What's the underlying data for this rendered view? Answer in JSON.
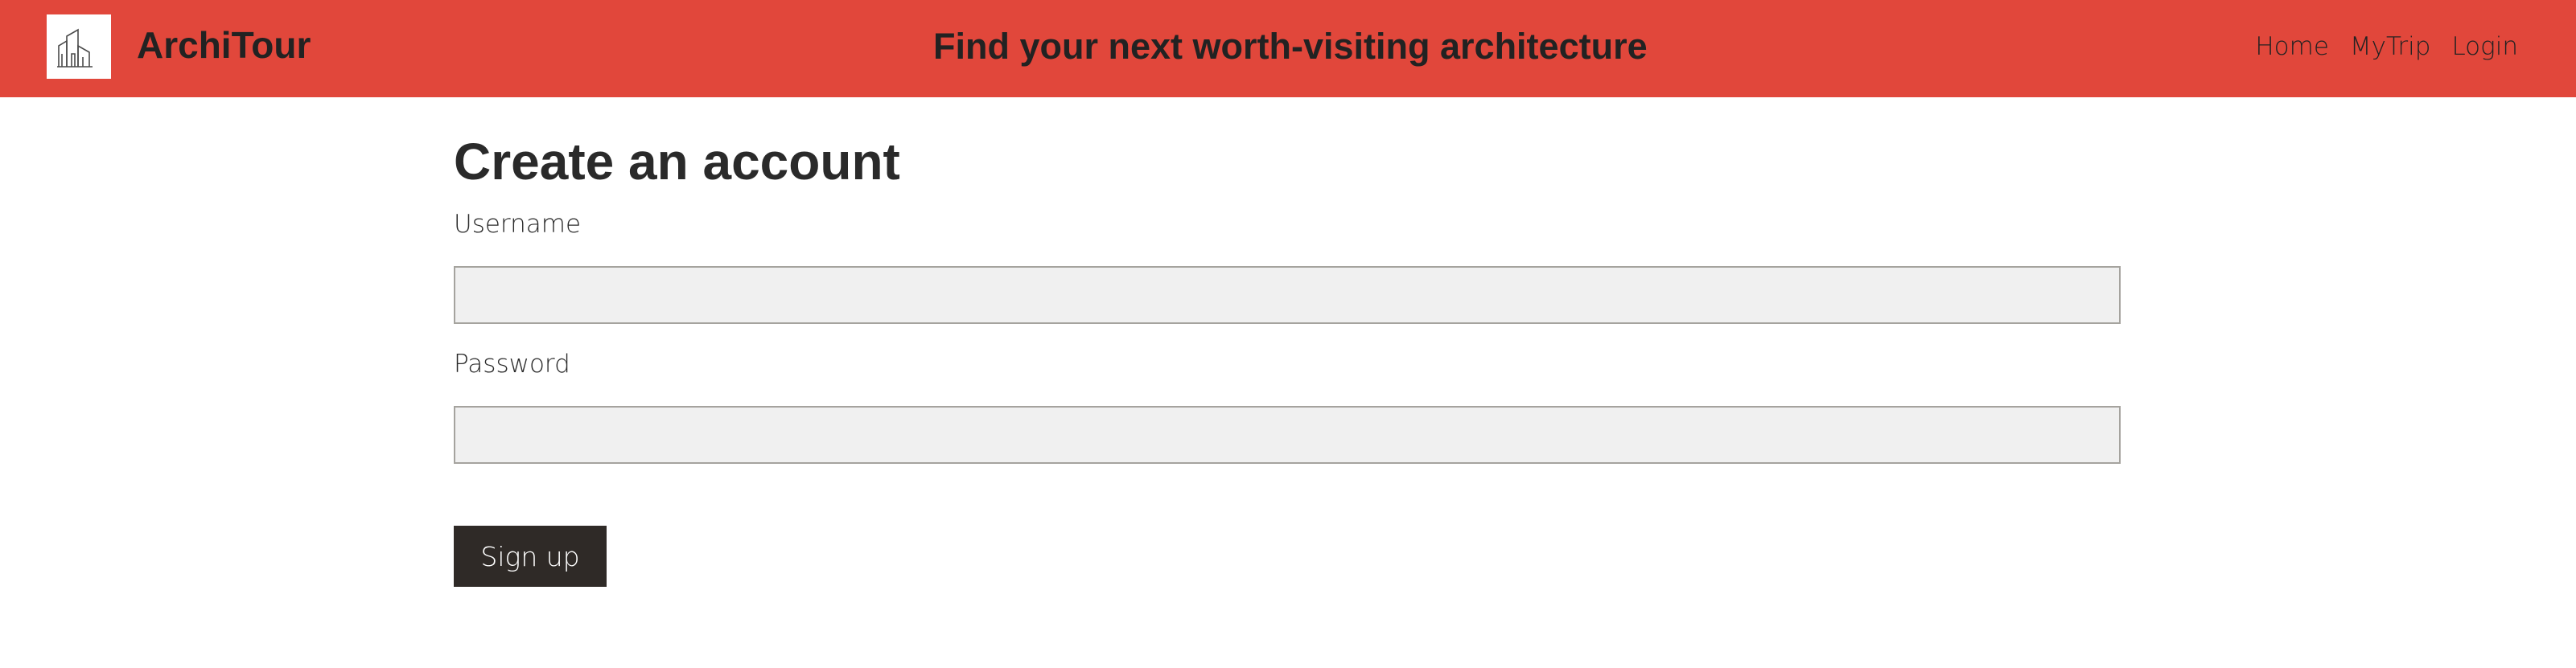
{
  "header": {
    "brand": "ArchiTour",
    "logo_icon": "buildings-icon",
    "tagline": "Find your next worth-visiting architecture",
    "nav": [
      {
        "label": "Home"
      },
      {
        "label": "MyTrip"
      },
      {
        "label": "Login"
      }
    ],
    "background_color": "#e1473b"
  },
  "form": {
    "title": "Create an account",
    "username_label": "Username",
    "username_value": "",
    "password_label": "Password",
    "password_value": "",
    "submit_label": "Sign up",
    "submit_color": "#2f2a27"
  }
}
